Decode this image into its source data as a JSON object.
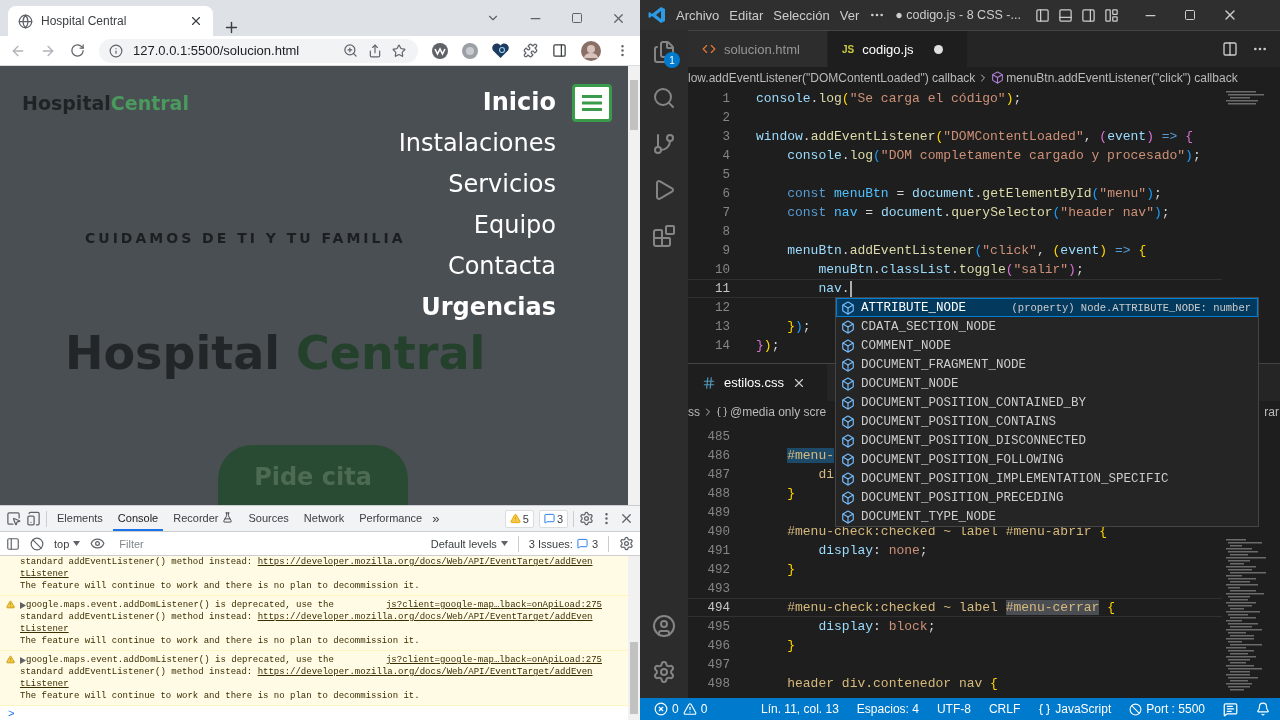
{
  "browser": {
    "tab": {
      "title": "Hospital Central",
      "selected": true
    },
    "url": "127.0.0.1:5500/solucion.html",
    "page": {
      "logo": {
        "first": "Hospital",
        "second": "Central"
      },
      "nav": [
        {
          "label": "Inicio",
          "bold": true
        },
        {
          "label": "Instalaciones",
          "bold": false
        },
        {
          "label": "Servicios",
          "bold": false
        },
        {
          "label": "Equipo",
          "bold": false
        },
        {
          "label": "Contacta",
          "bold": false
        },
        {
          "label": "Urgencias",
          "bold": true
        }
      ],
      "tagline": "CUIDAMOS DE TI Y TU FAMILIA",
      "heading": {
        "first": "Hospital",
        "second": "Central"
      },
      "cta": "Pide cita"
    },
    "devtools": {
      "tabs": [
        {
          "label": "Elements",
          "selected": false,
          "kind": "plain"
        },
        {
          "label": "Console",
          "selected": true,
          "kind": "plain"
        },
        {
          "label": "Recorder",
          "selected": false,
          "kind": "experimental"
        },
        {
          "label": "Sources",
          "selected": false,
          "kind": "plain"
        },
        {
          "label": "Network",
          "selected": false,
          "kind": "plain"
        },
        {
          "label": "Performance",
          "selected": false,
          "kind": "plain"
        }
      ],
      "more_tabs": "»",
      "warnings": "5",
      "messages": "3",
      "context": "top",
      "filter_placeholder": "Filter",
      "levels": "Default levels",
      "issues_label": "3 Issues:",
      "issues_count": "3",
      "console": [
        {
          "kind": "continuation",
          "prefix": "standard addEventListener() method instead:",
          "link": "https://developer.mozilla.org/docs/Web/API/EventTarget/addEven",
          "link_tail": "tListener",
          "note": "The feature will continue to work and there is no plan to decommission it."
        },
        {
          "kind": "warning",
          "summary": "google.maps.event.addDomListener() is deprecated, use the",
          "source": "js?client=google-map…lback=onApiLoad:275",
          "prefix": "standard addEventListener() method instead:",
          "link": "https://developer.mozilla.org/docs/Web/API/EventTarget/addEven",
          "link_tail": "tListener",
          "note": "The feature will continue to work and there is no plan to decommission it."
        },
        {
          "kind": "warning",
          "summary": "google.maps.event.addDomListener() is deprecated, use the",
          "source": "js?client=google-map…lback=onApiLoad:275",
          "prefix": "standard addEventListener() method instead:",
          "link": "https://developer.mozilla.org/docs/Web/API/EventTarget/addEven",
          "link_tail": "tListener",
          "note": "The feature will continue to work and there is no plan to decommission it."
        }
      ],
      "prompt": ">"
    }
  },
  "vscode": {
    "menu": [
      "Archivo",
      "Editar",
      "Selección",
      "Ver"
    ],
    "title": "● codigo.js - 8 CSS -...",
    "explorer_badge": "1",
    "editor1": {
      "tabs": [
        {
          "label": "solucion.html",
          "kind": "html",
          "selected": false,
          "dirty": false
        },
        {
          "label": "codigo.js",
          "kind": "js",
          "icon_label": "JS",
          "selected": true,
          "dirty": true
        }
      ],
      "breadcrumb": [
        "low.addEventListener(\"DOMContentLoaded\") callback",
        "menuBtn.addEventListener(\"click\") callback"
      ],
      "lines": [
        {
          "n": "1",
          "current": false,
          "text": "console.log(\"Se carga el código\");"
        },
        {
          "n": "2",
          "current": false
        },
        {
          "n": "3",
          "current": false,
          "text": "window.addEventListener(\"DOMContentLoaded\", (event) => {"
        },
        {
          "n": "4",
          "current": false,
          "text": "    console.log(\"DOM completamente cargado y procesado\");"
        },
        {
          "n": "5",
          "current": false
        },
        {
          "n": "6",
          "current": false,
          "text": "    const menuBtn = document.getElementById(\"menu\");"
        },
        {
          "n": "7",
          "current": false,
          "text": "    const nav = document.querySelector(\"header nav\");"
        },
        {
          "n": "8",
          "current": false
        },
        {
          "n": "9",
          "current": false,
          "text": "    menuBtn.addEventListener(\"click\", (event) => {"
        },
        {
          "n": "10",
          "current": false,
          "text": "        menuBtn.classList.toggle(\"salir\");"
        },
        {
          "n": "11",
          "current": true,
          "text": "        nav."
        },
        {
          "n": "12",
          "current": false
        },
        {
          "n": "13",
          "current": false,
          "text": "    });"
        },
        {
          "n": "14",
          "current": false,
          "text": "});"
        }
      ]
    },
    "suggestions": [
      {
        "label": "ATTRIBUTE_NODE",
        "detail": "(property) Node.ATTRIBUTE_NODE: number",
        "selected": true
      },
      {
        "label": "CDATA_SECTION_NODE",
        "selected": false
      },
      {
        "label": "COMMENT_NODE",
        "selected": false
      },
      {
        "label": "DOCUMENT_FRAGMENT_NODE",
        "selected": false
      },
      {
        "label": "DOCUMENT_NODE",
        "selected": false
      },
      {
        "label": "DOCUMENT_POSITION_CONTAINED_BY",
        "selected": false
      },
      {
        "label": "DOCUMENT_POSITION_CONTAINS",
        "selected": false
      },
      {
        "label": "DOCUMENT_POSITION_DISCONNECTED",
        "selected": false
      },
      {
        "label": "DOCUMENT_POSITION_FOLLOWING",
        "selected": false
      },
      {
        "label": "DOCUMENT_POSITION_IMPLEMENTATION_SPECIFIC",
        "selected": false
      },
      {
        "label": "DOCUMENT_POSITION_PRECEDING",
        "selected": false
      },
      {
        "label": "DOCUMENT_TYPE_NODE",
        "selected": false
      }
    ],
    "editor2": {
      "tabs": [
        {
          "label": "estilos.css",
          "kind": "css",
          "selected": true,
          "dirty": false
        }
      ],
      "breadcrumb": [
        "ss",
        "@media only scre"
      ],
      "breadcrumb_tail": "rar",
      "lines": [
        {
          "n": "485",
          "current": false
        },
        {
          "n": "486",
          "current": false,
          "parts": [
            {
              "text": "    #menu-",
              "highlighted": true
            }
          ]
        },
        {
          "n": "487",
          "current": false,
          "text": "        di"
        },
        {
          "n": "488",
          "current": false,
          "text": "    }"
        },
        {
          "n": "489",
          "current": false
        },
        {
          "n": "490",
          "current": false,
          "text": "    #menu-check:checked ~ label #menu-abrir {"
        },
        {
          "n": "491",
          "current": false,
          "text": "        display: none;"
        },
        {
          "n": "492",
          "current": false,
          "text": "    }"
        },
        {
          "n": "493",
          "current": false
        },
        {
          "n": "494",
          "current": true,
          "parts": [
            {
              "text": "    #menu-check:checked ~ label ",
              "highlighted": false
            },
            {
              "text": "#menu-cerrar",
              "highlighted": true
            },
            {
              "text": " {",
              "highlighted": false
            }
          ]
        },
        {
          "n": "495",
          "current": false,
          "text": "        display: block;"
        },
        {
          "n": "496",
          "current": false,
          "text": "    }"
        },
        {
          "n": "497",
          "current": false
        },
        {
          "n": "498",
          "current": false,
          "text": "    header div.contenedor nav {"
        }
      ]
    },
    "status": {
      "errors": "0",
      "warnings": "0",
      "items": [
        "Lín. 11, col. 13",
        "Espacios: 4",
        "UTF-8",
        "CRLF"
      ],
      "language": "JavaScript",
      "port": "Port : 5500"
    }
  }
}
